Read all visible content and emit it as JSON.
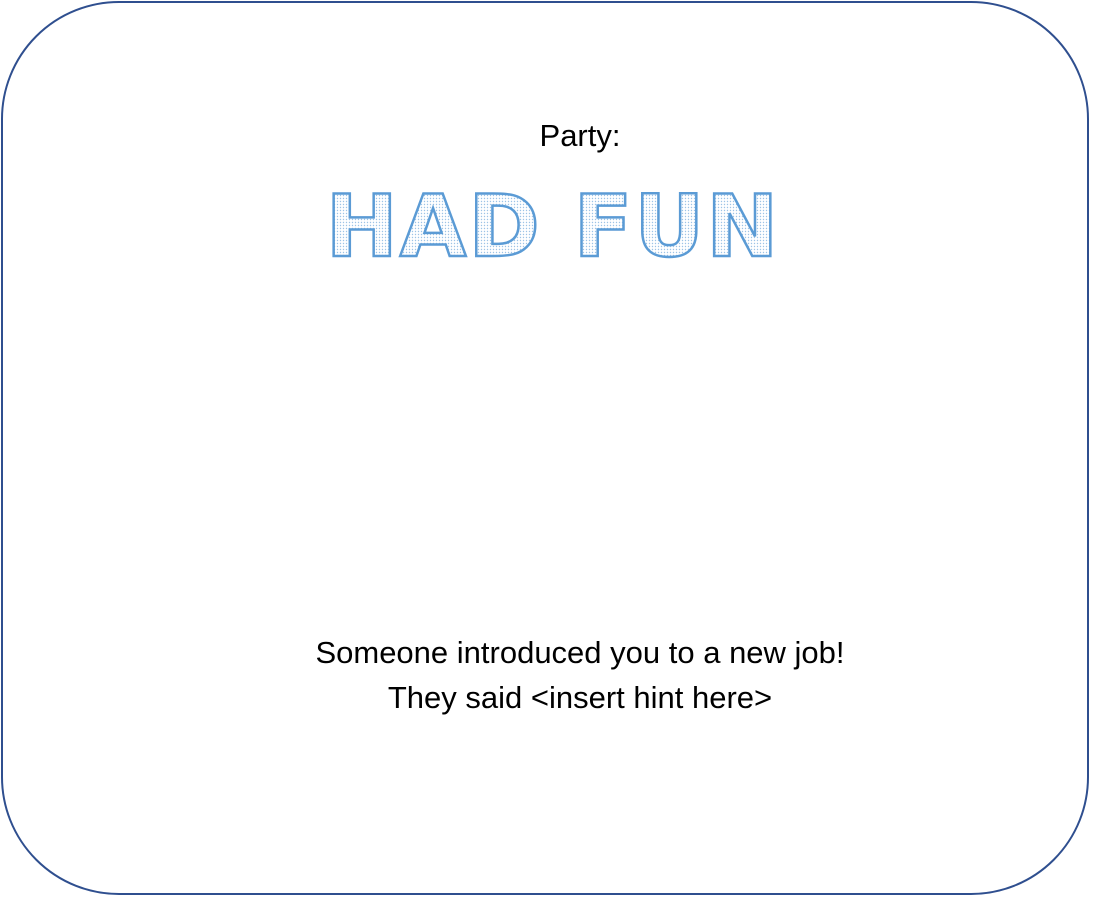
{
  "card": {
    "title": "Party:",
    "headline": "HAD FUN",
    "message_line1": "Someone introduced you to a new job!",
    "message_line2": "They said <insert hint here>"
  },
  "colors": {
    "border": "#2f4f8f",
    "headline_outline": "#5b9bd5",
    "headline_fill_pattern": "#9dc3e6",
    "text": "#000000"
  }
}
